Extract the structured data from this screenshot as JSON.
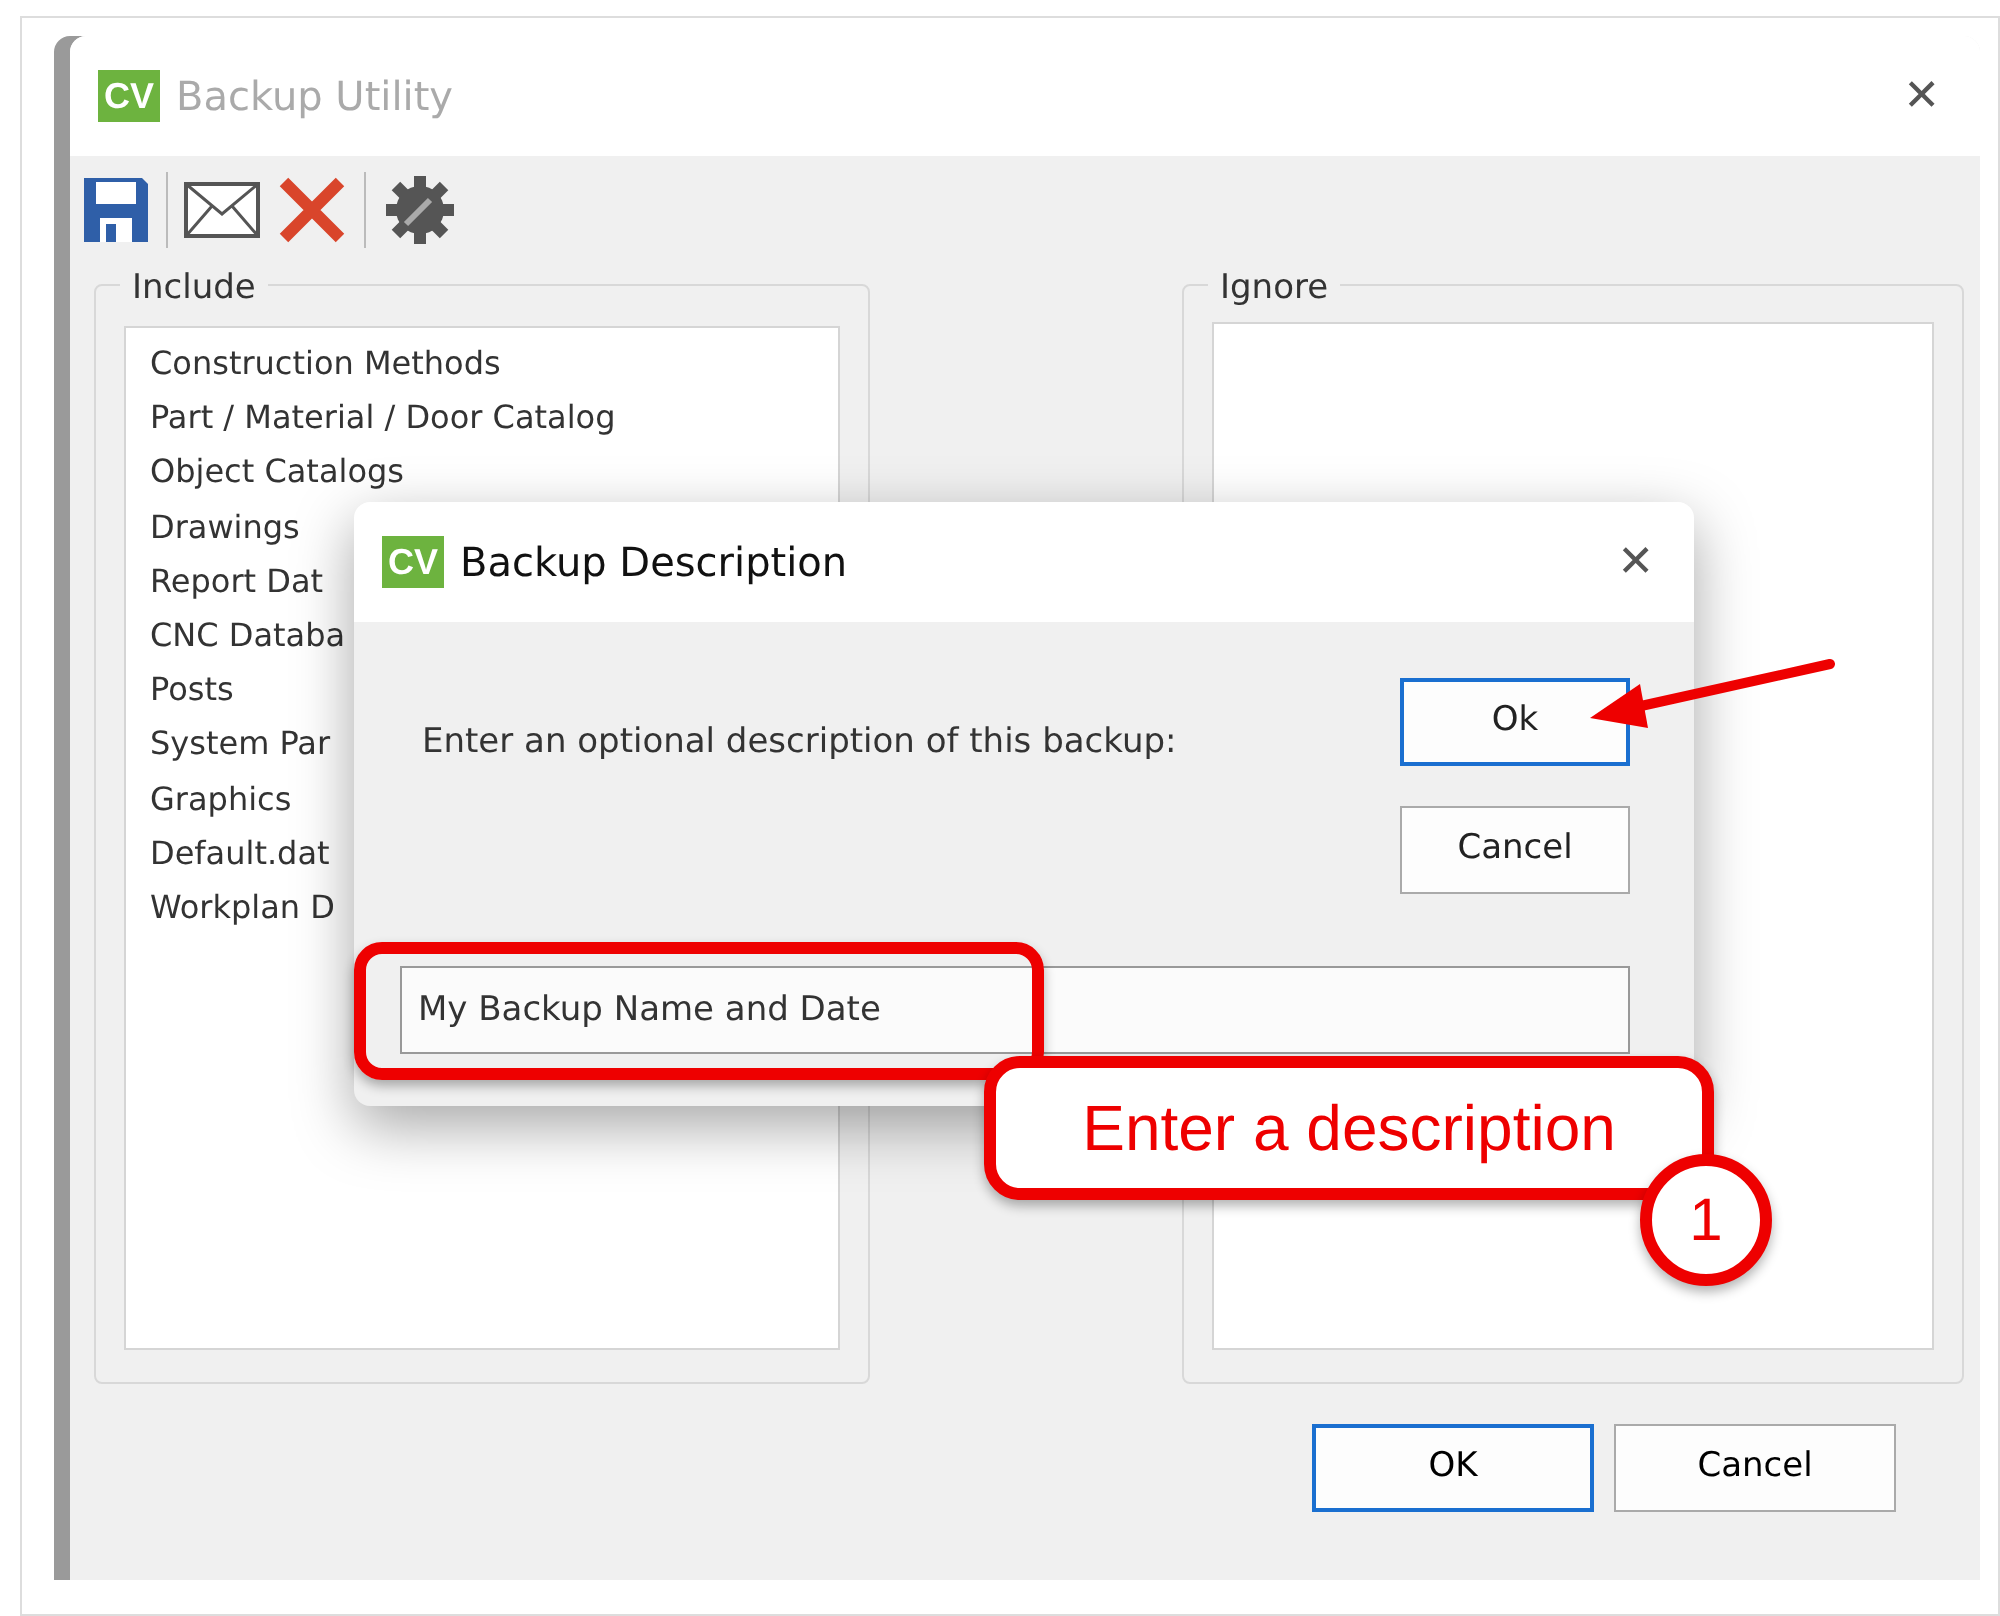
{
  "window": {
    "logo": "CV",
    "title": "Backup Utility",
    "close": "✕"
  },
  "include": {
    "label": "Include",
    "items": [
      "Construction Methods",
      "Part / Material / Door Catalog",
      "Object Catalogs",
      "Drawings",
      "Report Dat",
      "CNC Databa",
      "Posts",
      "System Par",
      "Graphics",
      "Default.dat",
      "Workplan D"
    ]
  },
  "ignore": {
    "label": "Ignore"
  },
  "buttons": [
    "OK",
    "Cancel"
  ],
  "dialog": {
    "logo": "CV",
    "title": "Backup Description",
    "close": "✕",
    "prompt": "Enter an optional description of this backup:",
    "buttons": [
      {
        "label": "Ok",
        "selected": true
      },
      {
        "label": "Cancel",
        "selected": false
      }
    ],
    "field_value": "My Backup Name and Date"
  },
  "callout": {
    "text": "Enter a description",
    "step": "1"
  }
}
